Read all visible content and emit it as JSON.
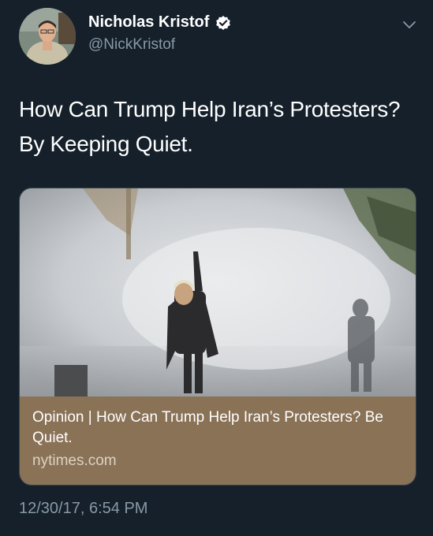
{
  "author": {
    "name": "Nicholas Kristof",
    "handle": "@NickKristof",
    "verified": true,
    "avatar_icon": "profile-photo"
  },
  "tweet": {
    "text": "How Can Trump Help Iran’s Protesters? By Keeping Quiet.",
    "timestamp": "12/30/17, 6:54 PM"
  },
  "link_card": {
    "title": "Opinion | How Can Trump Help Iran’s Protesters? Be Quiet.",
    "domain": "nytimes.com",
    "image_icon": "protest-photo"
  },
  "colors": {
    "background": "#15202b",
    "secondary_text": "#8899a6",
    "verified_badge": "#ffffff",
    "card_footer": "#8a7257"
  }
}
